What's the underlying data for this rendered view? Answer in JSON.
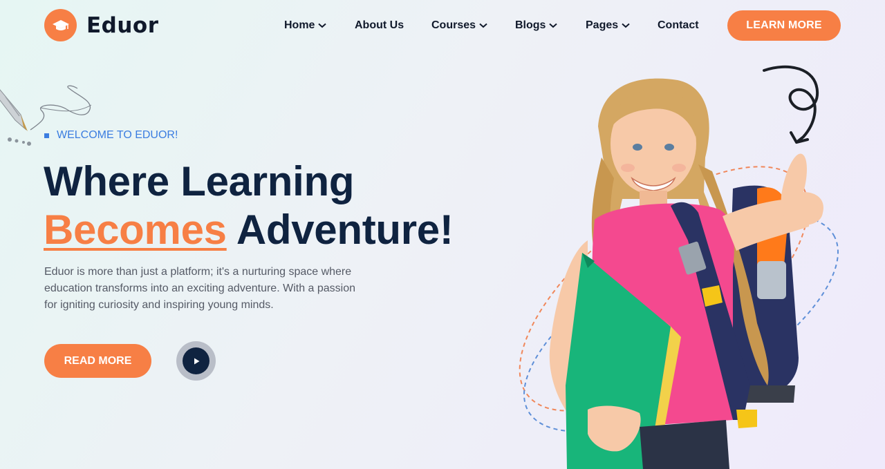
{
  "brand": {
    "name": "Eduor",
    "accent_color": "#f77f45",
    "navy_color": "#0f2340",
    "logo_icon": "graduation-cap-icon"
  },
  "nav": {
    "items": [
      {
        "label": "Home",
        "has_dropdown": true
      },
      {
        "label": "About Us",
        "has_dropdown": false
      },
      {
        "label": "Courses",
        "has_dropdown": true
      },
      {
        "label": "Blogs",
        "has_dropdown": true
      },
      {
        "label": "Pages",
        "has_dropdown": true
      },
      {
        "label": "Contact",
        "has_dropdown": false
      }
    ],
    "cta_label": "LEARN MORE"
  },
  "hero": {
    "eyebrow": "WELCOME TO EDUOR!",
    "headline_line1": "Where Learning",
    "headline_accent": "Becomes",
    "headline_rest": " Adventure!",
    "description": "Eduor is more than just a platform; it's a nurturing space where education transforms into an exciting adventure. With a passion for igniting curiosity and inspiring young minds.",
    "primary_button": "READ MORE",
    "play_icon": "play-icon"
  }
}
